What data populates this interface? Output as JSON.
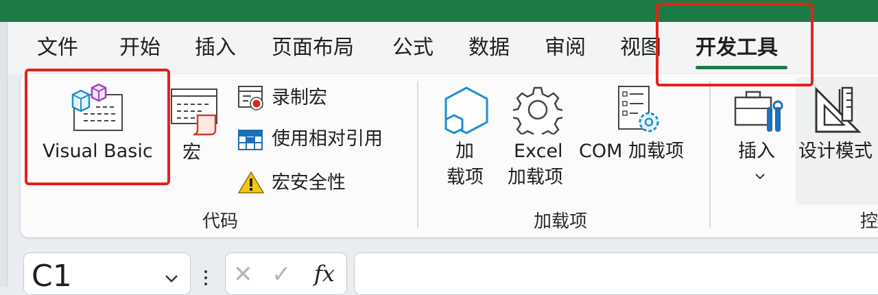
{
  "tabs": [
    "文件",
    "开始",
    "插入",
    "页面布局",
    "公式",
    "数据",
    "审阅",
    "视图",
    "开发工具"
  ],
  "active_tab": "开发工具",
  "ribbon": {
    "code_group": {
      "label": "代码",
      "visual_basic": "Visual Basic",
      "macros": "宏",
      "record_macro": "录制宏",
      "relative_ref": "使用相对引用",
      "macro_security": "宏安全性"
    },
    "addins_group": {
      "label": "加载项",
      "addins_line1": "加",
      "addins_line2": "载项",
      "excel_addins_line1": "Excel",
      "excel_addins_line2": "加载项",
      "com_addins": "COM 加载项"
    },
    "controls_group": {
      "label_partial": "控",
      "insert": "插入",
      "design_mode": "设计模式"
    }
  },
  "formula_bar": {
    "name_box": "C1",
    "cancel_symbol": "✕",
    "enter_symbol": "✓",
    "fx_symbol": "fx"
  },
  "colors": {
    "title_green": "#1e7a45",
    "highlight_red": "#e3221c"
  }
}
